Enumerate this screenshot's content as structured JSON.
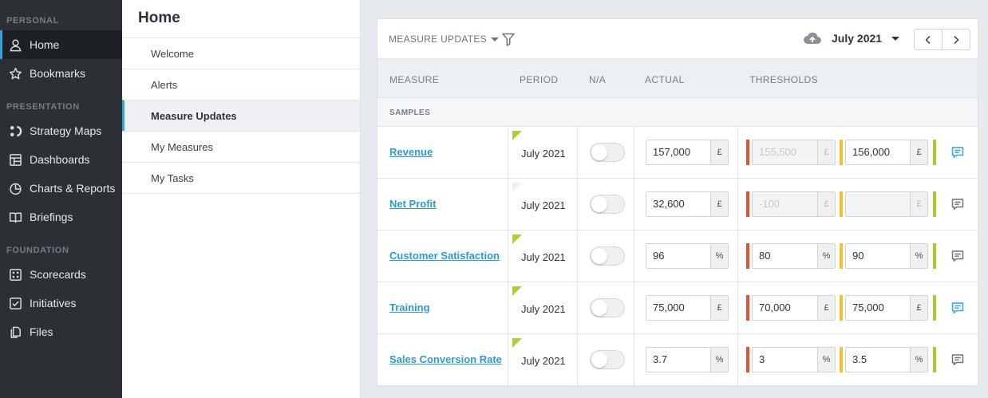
{
  "sidebar": {
    "sections": [
      {
        "label": "PERSONAL"
      },
      {
        "label": "PRESENTATION"
      },
      {
        "label": "FOUNDATION"
      }
    ],
    "items": [
      {
        "label": "Home",
        "icon": "user-icon"
      },
      {
        "label": "Bookmarks",
        "icon": "star-icon"
      },
      {
        "label": "Strategy Maps",
        "icon": "strategy-map-icon"
      },
      {
        "label": "Dashboards",
        "icon": "dashboard-icon"
      },
      {
        "label": "Charts & Reports",
        "icon": "pie-chart-icon"
      },
      {
        "label": "Briefings",
        "icon": "book-icon"
      },
      {
        "label": "Scorecards",
        "icon": "scorecard-icon"
      },
      {
        "label": "Initiatives",
        "icon": "checkbox-icon"
      },
      {
        "label": "Files",
        "icon": "files-icon"
      }
    ]
  },
  "subnav": {
    "title": "Home",
    "items": [
      {
        "label": "Welcome"
      },
      {
        "label": "Alerts"
      },
      {
        "label": "Measure Updates"
      },
      {
        "label": "My Measures"
      },
      {
        "label": "My Tasks"
      }
    ]
  },
  "toolbar": {
    "title": "MEASURE UPDATES",
    "period": "July 2021"
  },
  "table": {
    "headers": {
      "measure": "MEASURE",
      "period": "PERIOD",
      "na": "N/A",
      "actual": "ACTUAL",
      "thresholds": "THRESHOLDS"
    },
    "group": "SAMPLES",
    "rows": [
      {
        "name": "Revenue",
        "period": "July 2021",
        "actual": "157,000",
        "actual_unit": "£",
        "t1": "155,500",
        "t1_unit": "£",
        "t2": "156,000",
        "t2_unit": "£"
      },
      {
        "name": "Net Profit",
        "period": "July 2021",
        "actual": "32,600",
        "actual_unit": "£",
        "t1": "-100",
        "t1_unit": "£",
        "t2": "",
        "t2_unit": "£"
      },
      {
        "name": "Customer Satisfaction",
        "period": "July 2021",
        "actual": "96",
        "actual_unit": "%",
        "t1": "80",
        "t1_unit": "%",
        "t2": "90",
        "t2_unit": "%"
      },
      {
        "name": "Training",
        "period": "July 2021",
        "actual": "75,000",
        "actual_unit": "£",
        "t1": "70,000",
        "t1_unit": "£",
        "t2": "75,000",
        "t2_unit": "£"
      },
      {
        "name": "Sales Conversion Rate",
        "period": "July 2021",
        "actual": "3.7",
        "actual_unit": "%",
        "t1": "3",
        "t1_unit": "%",
        "t2": "3.5",
        "t2_unit": "%"
      }
    ]
  },
  "colors": {
    "accent": "#36a3d9",
    "threshold_red": "#e0542f",
    "threshold_amber": "#f2c12e",
    "threshold_green": "#a9cc2a"
  }
}
